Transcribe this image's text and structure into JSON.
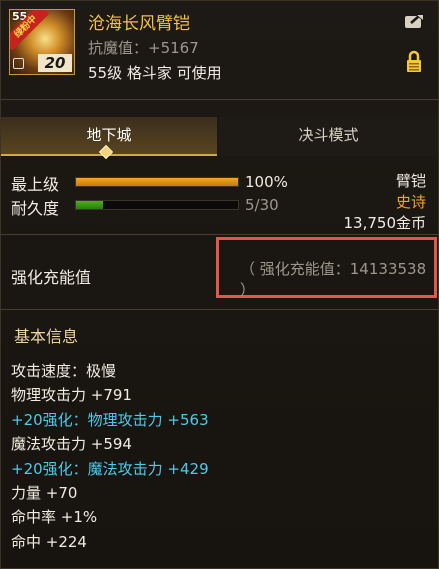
{
  "item": {
    "icon_level": "55",
    "icon_badge": "绿粉中",
    "icon_upgrade": "20",
    "name": "沧海长风臂铠",
    "resist": "抗魔值：+5167",
    "usable": "55级 格斗家 可使用"
  },
  "tabs": [
    {
      "label": "地下城",
      "active": true
    },
    {
      "label": "决斗模式",
      "active": false
    }
  ],
  "stats": {
    "grade": {
      "label": "最上级",
      "value": "100%",
      "fraction": 1.0,
      "color": "#f5a623"
    },
    "durability": {
      "label": "耐久度",
      "value": "5/30",
      "fraction": 0.1667,
      "color": "#4caf1e"
    }
  },
  "meta": {
    "type": "臂铠",
    "rarity": "史诗",
    "rarity_color": "#f5a623",
    "price": "13,750金币"
  },
  "charge": {
    "label": "强化充能值",
    "value": "（ 强化充能值：14133538 ）"
  },
  "basic_info": {
    "title": "基本信息",
    "lines": [
      {
        "text": "攻击速度：极慢",
        "color": "white"
      },
      {
        "text": "物理攻击力 +791",
        "color": "white"
      },
      {
        "text": "+20强化：物理攻击力 +563",
        "color": "cyan"
      },
      {
        "text": "魔法攻击力 +594",
        "color": "white"
      },
      {
        "text": "+20强化：魔法攻击力 +429",
        "color": "cyan"
      },
      {
        "text": "力量 +70",
        "color": "white"
      },
      {
        "text": "命中率 +1%",
        "color": "white"
      },
      {
        "text": "命中 +224",
        "color": "white"
      }
    ]
  },
  "colors": {
    "accent_gold": "#f3c43c",
    "highlight_red": "#e2574c",
    "enhance_cyan": "#4bcbeb"
  }
}
